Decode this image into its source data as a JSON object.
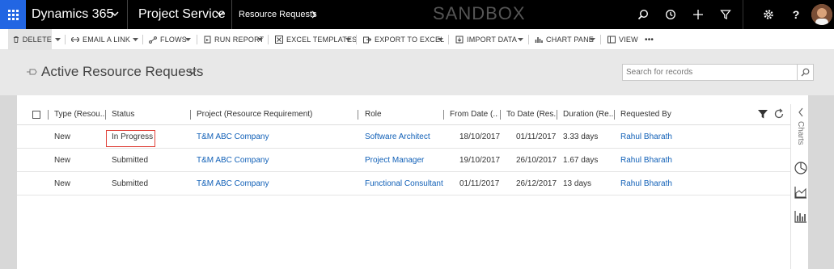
{
  "topbar": {
    "app_name": "Dynamics 365",
    "area_name": "Project Service",
    "breadcrumb": "Resource Requests",
    "environment": "SANDBOX",
    "icons": [
      "app-launcher-icon",
      "search-icon",
      "recent-icon",
      "plus-icon",
      "filter-icon",
      "settings-icon",
      "help-icon",
      "avatar"
    ]
  },
  "command_bar": {
    "delete": "DELETE",
    "email_link": "EMAIL A LINK",
    "flows": "FLOWS",
    "run_report": "RUN REPORT",
    "excel_templates": "EXCEL TEMPLATES",
    "export_excel": "EXPORT TO EXCEL",
    "import_data": "IMPORT DATA",
    "chart_pane": "CHART PANE",
    "view": "VIEW",
    "more": "•••"
  },
  "view": {
    "title": "Active Resource Requests",
    "search_placeholder": "Search for records"
  },
  "grid": {
    "columns": {
      "type": "Type (Resou...",
      "status": "Status",
      "project": "Project (Resource Requirement)",
      "role": "Role",
      "from_date": "From Date (...",
      "to_date": "To Date (Res...",
      "duration": "Duration (Re...",
      "requested_by": "Requested By"
    },
    "rows": [
      {
        "type": "New",
        "status": "In Progress",
        "project": "T&M ABC Company",
        "role": "Software Architect",
        "from_date": "18/10/2017",
        "to_date": "01/11/2017",
        "duration": "3.33 days",
        "requested_by": "Rahul Bharath"
      },
      {
        "type": "New",
        "status": "Submitted",
        "project": "T&M ABC Company",
        "role": "Project Manager",
        "from_date": "19/10/2017",
        "to_date": "26/10/2017",
        "duration": "1.67 days",
        "requested_by": "Rahul Bharath"
      },
      {
        "type": "New",
        "status": "Submitted",
        "project": "T&M ABC Company",
        "role": "Functional Consultant",
        "from_date": "01/11/2017",
        "to_date": "26/12/2017",
        "duration": "13 days",
        "requested_by": "Rahul Bharath"
      }
    ]
  },
  "charts_pane": {
    "label": "Charts",
    "icons": [
      "collapse-icon",
      "pie-chart-icon",
      "area-chart-icon",
      "bar-chart-icon"
    ]
  },
  "colors": {
    "launcher": "#2266e3",
    "link": "#1160b7",
    "highlight_border": "#e0433b"
  }
}
